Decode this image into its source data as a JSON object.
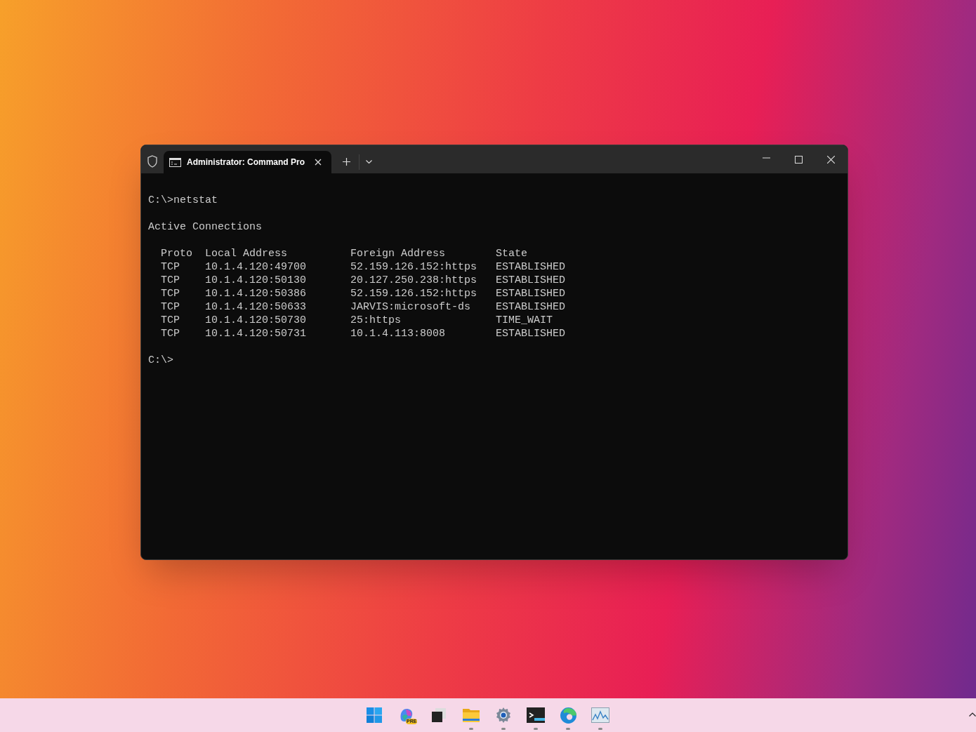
{
  "window": {
    "tab": {
      "title": "Administrator: Command Pro",
      "selected": true
    }
  },
  "console": {
    "blocks": [
      [
        "C:\\>netstat"
      ],
      [
        "Active Connections"
      ],
      [
        "  Proto  Local Address          Foreign Address        State",
        "  TCP    10.1.4.120:49700       52.159.126.152:https   ESTABLISHED",
        "  TCP    10.1.4.120:50130       20.127.250.238:https   ESTABLISHED",
        "  TCP    10.1.4.120:50386       52.159.126.152:https   ESTABLISHED",
        "  TCP    10.1.4.120:50633       JARVIS:microsoft-ds    ESTABLISHED",
        "  TCP    10.1.4.120:50730       25:https               TIME_WAIT",
        "  TCP    10.1.4.120:50731       10.1.4.113:8008        ESTABLISHED"
      ],
      [
        "C:\\>"
      ]
    ]
  },
  "taskbar": {
    "apps": [
      {
        "kind": "start",
        "running": false
      },
      {
        "kind": "copilot",
        "badge": "PRE",
        "running": false
      },
      {
        "kind": "taskview",
        "running": false
      },
      {
        "kind": "folder",
        "running": true
      },
      {
        "kind": "settings",
        "running": true
      },
      {
        "kind": "terminal",
        "running": true
      },
      {
        "kind": "browser",
        "running": true
      },
      {
        "kind": "monitor",
        "running": true
      }
    ]
  }
}
